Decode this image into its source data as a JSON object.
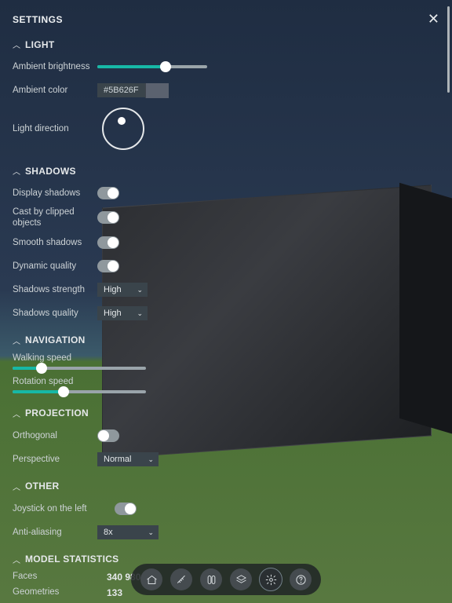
{
  "header": {
    "title": "SETTINGS"
  },
  "sections": {
    "light": {
      "title": "LIGHT",
      "ambient_brightness_label": "Ambient brightness",
      "ambient_brightness_pct": 62,
      "ambient_color_label": "Ambient color",
      "ambient_color_hex": "#5B626F",
      "light_direction_label": "Light direction"
    },
    "shadows": {
      "title": "SHADOWS",
      "display_label": "Display shadows",
      "display_on": true,
      "cast_label": "Cast by clipped objects",
      "cast_on": true,
      "smooth_label": "Smooth shadows",
      "smooth_on": true,
      "dynamic_label": "Dynamic quality",
      "dynamic_on": true,
      "strength_label": "Shadows strength",
      "strength_value": "High",
      "quality_label": "Shadows quality",
      "quality_value": "High"
    },
    "navigation": {
      "title": "NAVIGATION",
      "walk_label": "Walking speed",
      "walk_pct": 22,
      "rot_label": "Rotation speed",
      "rot_pct": 38
    },
    "projection": {
      "title": "PROJECTION",
      "ortho_label": "Orthogonal",
      "ortho_on": false,
      "persp_label": "Perspective",
      "persp_value": "Normal"
    },
    "other": {
      "title": "OTHER",
      "joy_label": "Joystick on the left",
      "joy_on": true,
      "aa_label": "Anti-aliasing",
      "aa_value": "8x"
    },
    "stats": {
      "title": "MODEL STATISTICS",
      "faces_label": "Faces",
      "faces_value": "340 980",
      "geom_label": "Geometries",
      "geom_value": "133"
    }
  },
  "toolbar": {
    "home": "home-icon",
    "measure": "measure-icon",
    "section": "section-icon",
    "layers": "layers-icon",
    "settings": "gear-icon",
    "help": "help-icon"
  }
}
